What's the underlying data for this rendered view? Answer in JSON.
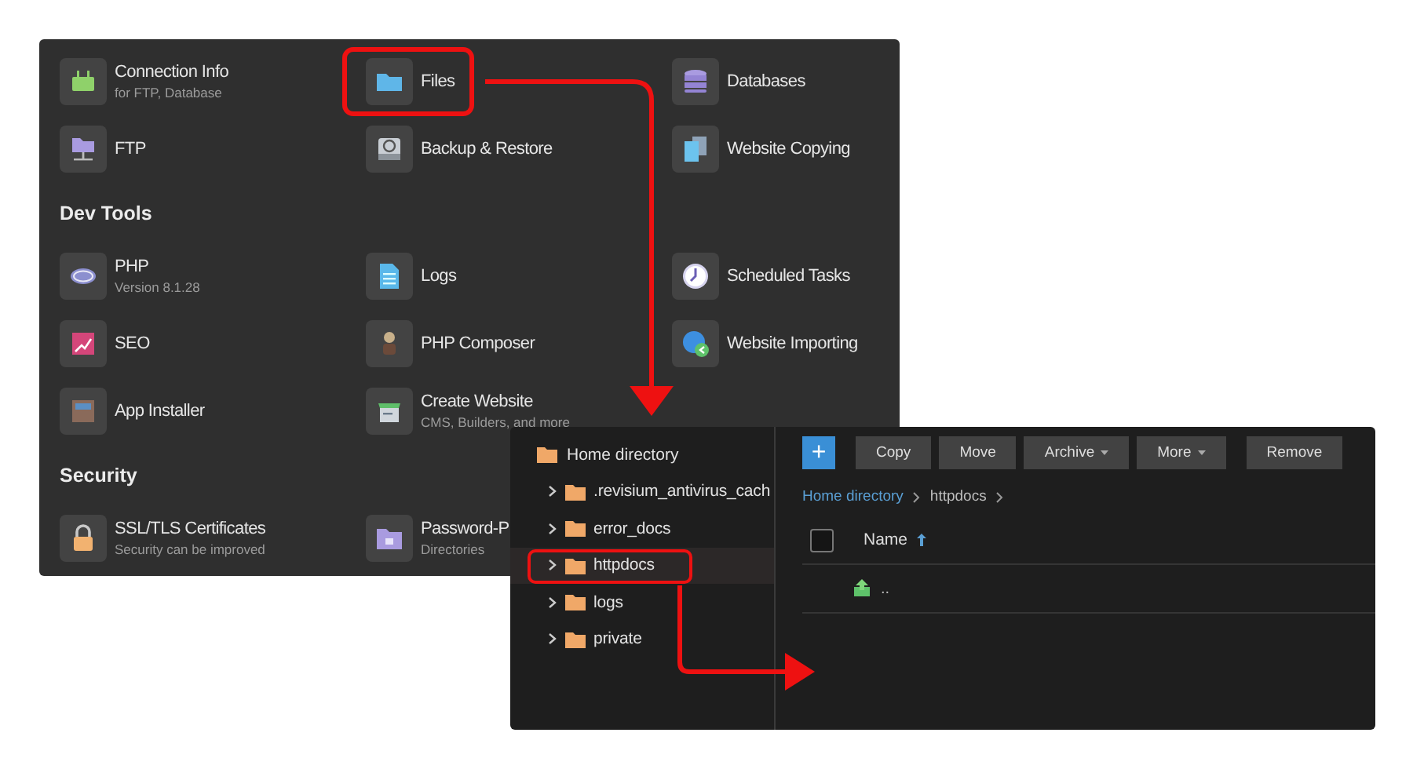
{
  "services_panel": {
    "sections": [
      {
        "items": [
          {
            "label": "Connection Info",
            "sublabel": "for FTP, Database",
            "highlighted": false
          },
          {
            "label": "Files",
            "highlighted": true
          },
          {
            "label": "Databases",
            "highlighted": false
          },
          {
            "label": "FTP",
            "highlighted": false
          },
          {
            "label": "Backup & Restore",
            "highlighted": false
          },
          {
            "label": "Website Copying",
            "highlighted": false
          }
        ]
      },
      {
        "title": "Dev Tools",
        "items": [
          {
            "label": "PHP",
            "sublabel": "Version 8.1.28",
            "highlighted": false
          },
          {
            "label": "Logs",
            "highlighted": false
          },
          {
            "label": "Scheduled Tasks",
            "highlighted": false
          },
          {
            "label": "SEO",
            "highlighted": false
          },
          {
            "label": "PHP Composer",
            "highlighted": false
          },
          {
            "label": "Website Importing",
            "highlighted": false
          },
          {
            "label": "App Installer",
            "highlighted": false
          },
          {
            "label": "Create Website",
            "sublabel": "CMS, Builders, and more",
            "highlighted": false
          }
        ]
      },
      {
        "title": "Security",
        "items": [
          {
            "label": "SSL/TLS Certificates",
            "sublabel": "Security can be improved",
            "highlighted": false
          },
          {
            "label": "Password-P",
            "sublabel": "Directories",
            "highlighted": false
          }
        ]
      }
    ]
  },
  "file_manager": {
    "tree": {
      "label": "Home directory",
      "children": [
        {
          "label": ".revisium_antivirus_cach",
          "expanded": false,
          "selected": false,
          "highlighted": false
        },
        {
          "label": "error_docs",
          "expanded": false,
          "selected": false,
          "highlighted": false
        },
        {
          "label": "httpdocs",
          "expanded": false,
          "selected": true,
          "highlighted": true
        },
        {
          "label": "logs",
          "expanded": false,
          "selected": false,
          "highlighted": false
        },
        {
          "label": "private",
          "expanded": false,
          "selected": false,
          "highlighted": false
        }
      ]
    },
    "add_button": "+",
    "toolbar": [
      {
        "label": "Copy",
        "dropdown": false
      },
      {
        "label": "Move",
        "dropdown": false
      },
      {
        "label": "Archive",
        "dropdown": true
      },
      {
        "label": "More",
        "dropdown": true
      },
      {
        "label": "Remove",
        "dropdown": false
      }
    ],
    "breadcrumb": [
      "Home directory",
      "httpdocs"
    ],
    "table": {
      "select_all": {
        "checked": false
      },
      "columns": [
        {
          "label": "Name",
          "sort_ascending": true
        }
      ],
      "rows": [
        {
          "name": ".."
        }
      ]
    }
  }
}
